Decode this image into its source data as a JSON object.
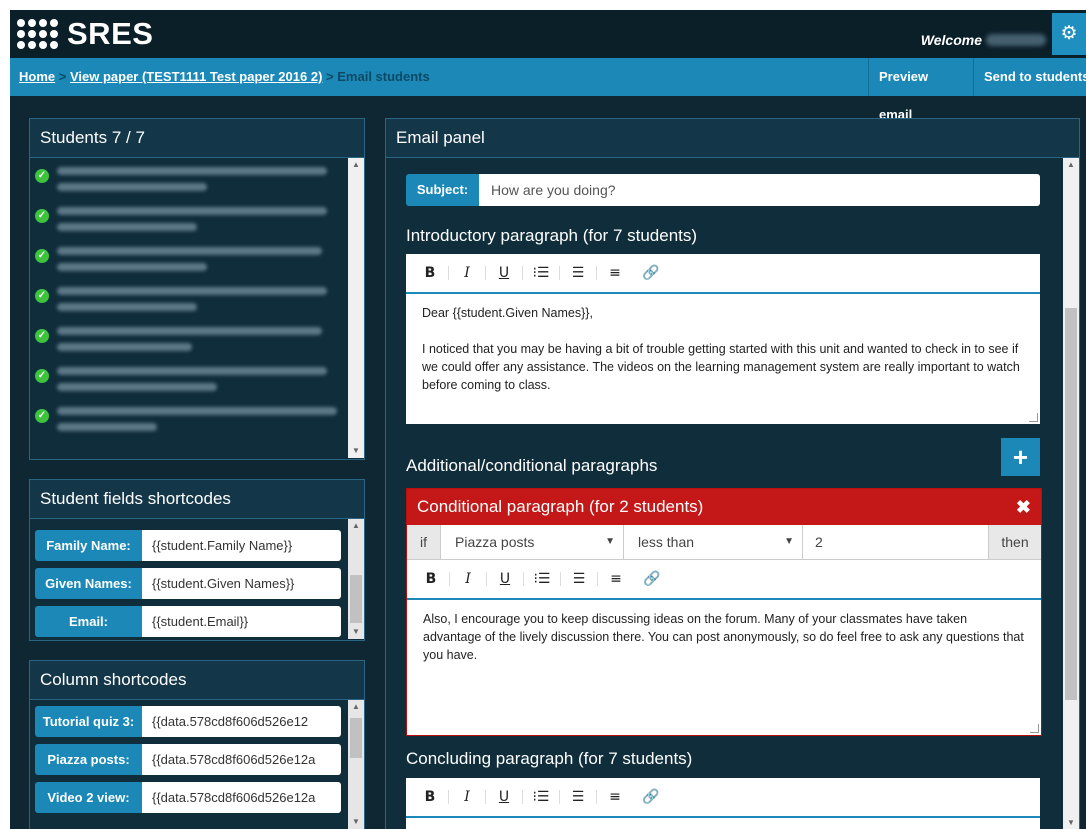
{
  "app": {
    "logo_text": "SRES",
    "welcome_label": "Welcome"
  },
  "breadcrumb": {
    "home": "Home",
    "separator": ">",
    "view_paper": "View paper (TEST1111 Test paper 2016 2)",
    "current": "Email students"
  },
  "actions": {
    "preview": "Preview email",
    "send": "Send to students"
  },
  "students_panel": {
    "title": "Students 7 / 7"
  },
  "fields_panel": {
    "title": "Student fields shortcodes",
    "rows": [
      {
        "label": "Family Name:",
        "value": "{{student.Family Name}}"
      },
      {
        "label": "Given Names:",
        "value": "{{student.Given Names}}"
      },
      {
        "label": "Email:",
        "value": "{{student.Email}}"
      }
    ]
  },
  "columns_panel": {
    "title": "Column shortcodes",
    "rows": [
      {
        "label": "Tutorial quiz 3:",
        "value": "{{data.578cd8f606d526e12"
      },
      {
        "label": "Piazza posts:",
        "value": "{{data.578cd8f606d526e12a"
      },
      {
        "label": "Video 2 view:",
        "value": "{{data.578cd8f606d526e12a"
      }
    ]
  },
  "email_panel": {
    "title": "Email panel",
    "subject_label": "Subject:",
    "subject_value": "How are you doing?",
    "intro_title": "Introductory paragraph (for 7 students)",
    "intro_p1": "Dear {{student.Given Names}},",
    "intro_p2": "I noticed that you may be having a bit of trouble getting started with this unit and wanted to check in to see if we could offer any assistance. The videos on the learning management system are really important to watch before coming to class.",
    "additional_title": "Additional/conditional paragraphs",
    "conditional": {
      "title": "Conditional paragraph (for 2 students)",
      "if_label": "if",
      "field": "Piazza posts",
      "operator": "less than",
      "value": "2",
      "then_label": "then",
      "text": "Also, I encourage you to keep discussing ideas on the forum. Many of your classmates have taken advantage of the lively discussion there. You can post anonymously, so do feel free to ask any questions that you have."
    },
    "concluding_title": "Concluding paragraph (for 7 students)"
  },
  "toolbar_icons": [
    "bold-icon",
    "italic-icon",
    "underline-icon",
    "ordered-list-icon",
    "bullet-list-icon",
    "align-left-icon",
    "link-icon"
  ],
  "colors": {
    "accent": "#1b88b7",
    "danger": "#c41717",
    "background": "#0e2733",
    "success": "#3cc43c"
  }
}
